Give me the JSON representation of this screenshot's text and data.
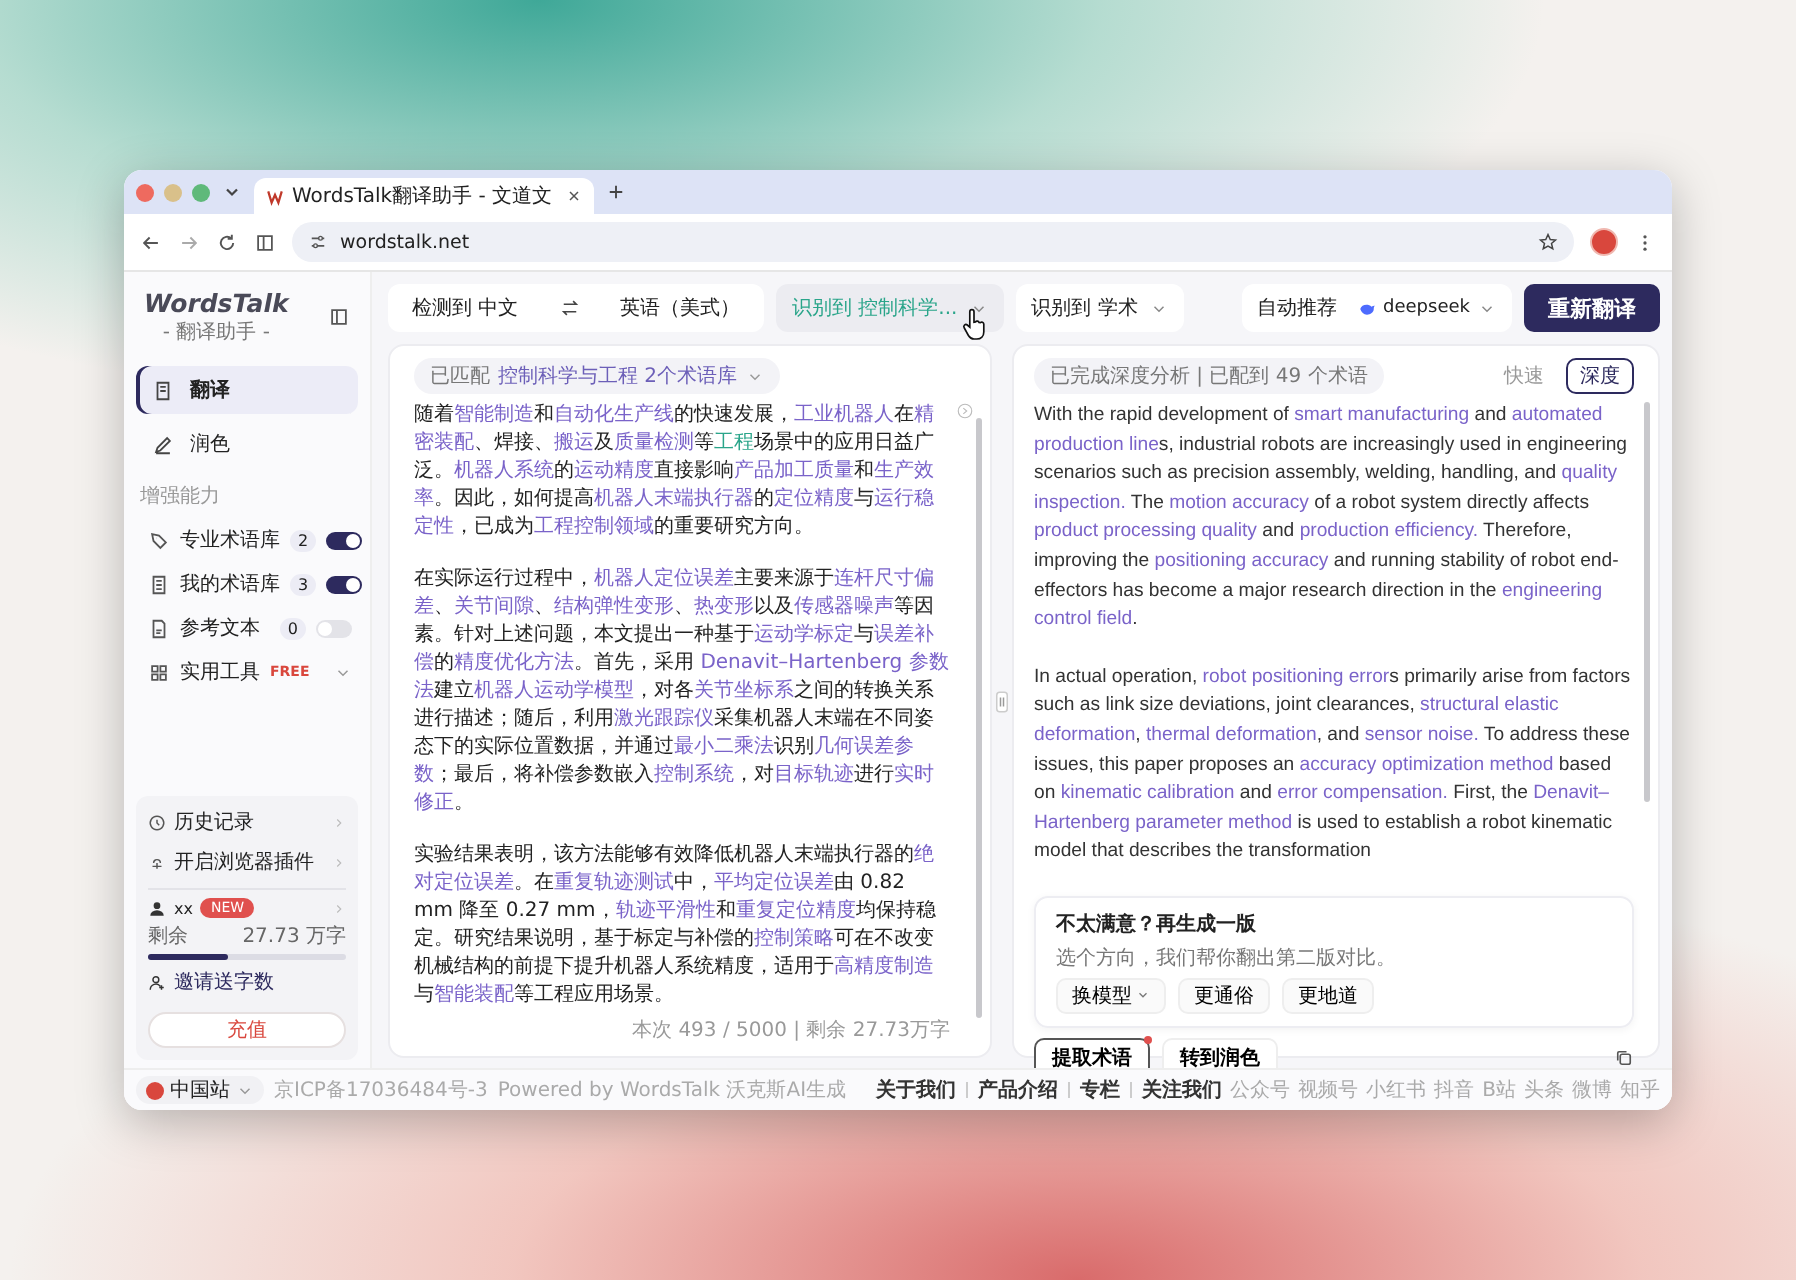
{
  "browser": {
    "tab_title": "WordsTalk翻译助手 - 文道文",
    "url": "wordstalk.net"
  },
  "sidebar": {
    "logo": "WordsTalk",
    "logo_sub": "- 翻译助手 -",
    "nav": [
      {
        "label": "翻译",
        "selected": true
      },
      {
        "label": "润色",
        "selected": false
      }
    ],
    "section_label": "增强能力",
    "tools": [
      {
        "kind": "toggle",
        "label": "专业术语库",
        "count": "2",
        "on": true
      },
      {
        "kind": "toggle",
        "label": "我的术语库",
        "count": "3",
        "on": true
      },
      {
        "kind": "toggle",
        "label": "参考文本",
        "count": "0",
        "on": false
      },
      {
        "kind": "menu",
        "label": "实用工具",
        "badge": "FREE"
      }
    ],
    "links": [
      {
        "label": "历史记录"
      },
      {
        "label": "开启浏览器插件"
      }
    ],
    "user": {
      "name": "xx",
      "badge": "NEW"
    },
    "quota": {
      "label": "剩余",
      "value": "27.73 万字",
      "level": 0.4
    },
    "invite": "邀请送字数",
    "recharge": "充值"
  },
  "toolbar": {
    "source_lang": "检测到 中文",
    "target_lang": "英语（美式）",
    "selectors": [
      {
        "label": "识别到 控制科学...",
        "hovered": true
      },
      {
        "label": "识别到 学术",
        "hovered": false
      }
    ],
    "model_label": "自动推荐",
    "model": "deepseek",
    "action": "重新翻译"
  },
  "source": {
    "chip_label": "已匹配",
    "chip_value": "控制科学与工程 2个术语库",
    "paragraphs": [
      [
        {
          "text": "随着",
          "kind": "plain"
        },
        {
          "text": "智能制造",
          "kind": "term"
        },
        {
          "text": "和",
          "kind": "plain"
        },
        {
          "text": "自动化生产线",
          "kind": "term"
        },
        {
          "text": "的快速发展，",
          "kind": "plain"
        },
        {
          "text": "工业机器人",
          "kind": "term"
        },
        {
          "text": "在",
          "kind": "plain"
        },
        {
          "text": "精密装配",
          "kind": "term"
        },
        {
          "text": "、焊接、",
          "kind": "plain"
        },
        {
          "text": "搬运",
          "kind": "term"
        },
        {
          "text": "及",
          "kind": "plain"
        },
        {
          "text": "质量检测",
          "kind": "term"
        },
        {
          "text": "等",
          "kind": "plain"
        },
        {
          "text": "工程",
          "kind": "hover"
        },
        {
          "text": "场景中的应用日益广泛。",
          "kind": "plain"
        },
        {
          "text": "机器人系统",
          "kind": "term"
        },
        {
          "text": "的",
          "kind": "plain"
        },
        {
          "text": "运动精度",
          "kind": "term"
        },
        {
          "text": "直接影响",
          "kind": "plain"
        },
        {
          "text": "产品加工质量",
          "kind": "term"
        },
        {
          "text": "和",
          "kind": "plain"
        },
        {
          "text": "生产效率",
          "kind": "term"
        },
        {
          "text": "。因此，如何提高",
          "kind": "plain"
        },
        {
          "text": "机器人末端执行器",
          "kind": "term"
        },
        {
          "text": "的",
          "kind": "plain"
        },
        {
          "text": "定位精度",
          "kind": "term"
        },
        {
          "text": "与",
          "kind": "plain"
        },
        {
          "text": "运行稳定性",
          "kind": "term"
        },
        {
          "text": "，已成为",
          "kind": "plain"
        },
        {
          "text": "工程控制领域",
          "kind": "term"
        },
        {
          "text": "的重要研究方向。",
          "kind": "plain"
        }
      ],
      [
        {
          "text": "在实际运行过程中，",
          "kind": "plain"
        },
        {
          "text": "机器人定位误差",
          "kind": "term"
        },
        {
          "text": "主要来源于",
          "kind": "plain"
        },
        {
          "text": "连杆尺寸偏差",
          "kind": "term"
        },
        {
          "text": "、",
          "kind": "plain"
        },
        {
          "text": "关节间隙",
          "kind": "term"
        },
        {
          "text": "、",
          "kind": "plain"
        },
        {
          "text": "结构弹性变形",
          "kind": "term"
        },
        {
          "text": "、",
          "kind": "plain"
        },
        {
          "text": "热变形",
          "kind": "term"
        },
        {
          "text": "以及",
          "kind": "plain"
        },
        {
          "text": "传感器噪声",
          "kind": "term"
        },
        {
          "text": "等因素。针对上述问题，本文提出一种基于",
          "kind": "plain"
        },
        {
          "text": "运动学标定",
          "kind": "term"
        },
        {
          "text": "与",
          "kind": "plain"
        },
        {
          "text": "误差补偿",
          "kind": "term"
        },
        {
          "text": "的",
          "kind": "plain"
        },
        {
          "text": "精度优化方法",
          "kind": "term"
        },
        {
          "text": "。首先，采用 ",
          "kind": "plain"
        },
        {
          "text": "Denavit–Hartenberg 参数法",
          "kind": "term"
        },
        {
          "text": "建立",
          "kind": "plain"
        },
        {
          "text": "机器人运动学模型",
          "kind": "term"
        },
        {
          "text": "，对各",
          "kind": "plain"
        },
        {
          "text": "关节坐标系",
          "kind": "term"
        },
        {
          "text": "之间的转换关系进行描述；随后，利用",
          "kind": "plain"
        },
        {
          "text": "激光跟踪仪",
          "kind": "term"
        },
        {
          "text": "采集机器人末端在不同姿态下的实际位置数据，并通过",
          "kind": "plain"
        },
        {
          "text": "最小二乘法",
          "kind": "term"
        },
        {
          "text": "识别",
          "kind": "plain"
        },
        {
          "text": "几何误差参数",
          "kind": "term"
        },
        {
          "text": "；最后，将补偿参数嵌入",
          "kind": "plain"
        },
        {
          "text": "控制系统",
          "kind": "term"
        },
        {
          "text": "，对",
          "kind": "plain"
        },
        {
          "text": "目标轨迹",
          "kind": "term"
        },
        {
          "text": "进行",
          "kind": "plain"
        },
        {
          "text": "实时修正",
          "kind": "term"
        },
        {
          "text": "。",
          "kind": "plain"
        }
      ],
      [
        {
          "text": "实验结果表明，该方法能够有效降低机器人末端执行器的",
          "kind": "plain"
        },
        {
          "text": "绝对定位误差",
          "kind": "term"
        },
        {
          "text": "。在",
          "kind": "plain"
        },
        {
          "text": "重复轨迹测试",
          "kind": "term"
        },
        {
          "text": "中，",
          "kind": "plain"
        },
        {
          "text": "平均定位误差",
          "kind": "term"
        },
        {
          "text": "由 0.82 mm 降至 0.27 mm，",
          "kind": "plain"
        },
        {
          "text": "轨迹平滑性",
          "kind": "term"
        },
        {
          "text": "和",
          "kind": "plain"
        },
        {
          "text": "重复定位精度",
          "kind": "term"
        },
        {
          "text": "均保持稳定。研究结果说明，基于标定与补偿的",
          "kind": "plain"
        },
        {
          "text": "控制策略",
          "kind": "term"
        },
        {
          "text": "可在不改变机械结构的前提下提升机器人系统精度，适用于",
          "kind": "plain"
        },
        {
          "text": "高精度制造",
          "kind": "term"
        },
        {
          "text": "与",
          "kind": "plain"
        },
        {
          "text": "智能装配",
          "kind": "term"
        },
        {
          "text": "等工程应用场景。",
          "kind": "plain"
        }
      ]
    ],
    "footer": "本次 493 / 5000 | 剩余 27.73万字"
  },
  "target": {
    "chip": "已完成深度分析 | 已配到 49 个术语",
    "modes": [
      {
        "label": "快速",
        "selected": false
      },
      {
        "label": "深度",
        "selected": true
      }
    ],
    "paragraphs": [
      [
        {
          "text": "With the rapid development of ",
          "kind": "plain"
        },
        {
          "text": "smart manufacturing",
          "kind": "term"
        },
        {
          "text": " and ",
          "kind": "plain"
        },
        {
          "text": "automated production line",
          "kind": "term"
        },
        {
          "text": "s, industrial robots are increasingly used in engineering scenarios such as precision assembly, welding, handling, and ",
          "kind": "plain"
        },
        {
          "text": "quality inspection.",
          "kind": "term"
        },
        {
          "text": " The ",
          "kind": "plain"
        },
        {
          "text": "motion accuracy",
          "kind": "term"
        },
        {
          "text": " of a robot system directly affects ",
          "kind": "plain"
        },
        {
          "text": "product processing quality",
          "kind": "term"
        },
        {
          "text": " and ",
          "kind": "plain"
        },
        {
          "text": "production efficiency.",
          "kind": "term"
        },
        {
          "text": " Therefore, improving the ",
          "kind": "plain"
        },
        {
          "text": "positioning accuracy",
          "kind": "term"
        },
        {
          "text": " and running stability of robot end-effectors has become a major research direction in the ",
          "kind": "plain"
        },
        {
          "text": "engineering control field",
          "kind": "term"
        },
        {
          "text": ".",
          "kind": "plain"
        }
      ],
      [
        {
          "text": "In actual operation, ",
          "kind": "plain"
        },
        {
          "text": "robot positioning error",
          "kind": "term"
        },
        {
          "text": "s primarily arise from factors such as link size deviations, joint clearances, ",
          "kind": "plain"
        },
        {
          "text": "structural elastic deformation",
          "kind": "term"
        },
        {
          "text": ", ",
          "kind": "plain"
        },
        {
          "text": "thermal deformation",
          "kind": "term"
        },
        {
          "text": ", and ",
          "kind": "plain"
        },
        {
          "text": "sensor noise.",
          "kind": "term"
        },
        {
          "text": " To address these issues, this paper proposes an ",
          "kind": "plain"
        },
        {
          "text": "accuracy optimization method",
          "kind": "term"
        },
        {
          "text": " based on ",
          "kind": "plain"
        },
        {
          "text": "kinematic calibration",
          "kind": "term"
        },
        {
          "text": " and ",
          "kind": "plain"
        },
        {
          "text": "error compensation.",
          "kind": "term"
        },
        {
          "text": " First, the ",
          "kind": "plain"
        },
        {
          "text": "Denavit–Hartenberg parameter method",
          "kind": "term"
        },
        {
          "text": " is used to establish a robot kinematic model that describes the transformation",
          "kind": "plain"
        }
      ]
    ],
    "regen": {
      "title": "不太满意？再生成一版",
      "subtitle": "选个方向，我们帮你翻出第二版对比。",
      "options": [
        {
          "label": "换模型",
          "dropdown": true
        },
        {
          "label": "更通俗",
          "dropdown": false
        },
        {
          "label": "更地道",
          "dropdown": false
        }
      ]
    },
    "actions": [
      {
        "label": "提取术语",
        "notified": true
      },
      {
        "label": "转到润色",
        "notified": false
      }
    ]
  },
  "footer": {
    "region": "中国站",
    "icp": "京ICP备17036484号-3",
    "powered": "Powered by WordsTalk 沃克斯AI生成",
    "links": [
      "关于我们",
      "产品介绍",
      "专栏"
    ],
    "follow": "关注我们",
    "socials": [
      "公众号",
      "视频号",
      "小红书",
      "抖音",
      "B站",
      "头条",
      "微博",
      "知乎"
    ]
  }
}
